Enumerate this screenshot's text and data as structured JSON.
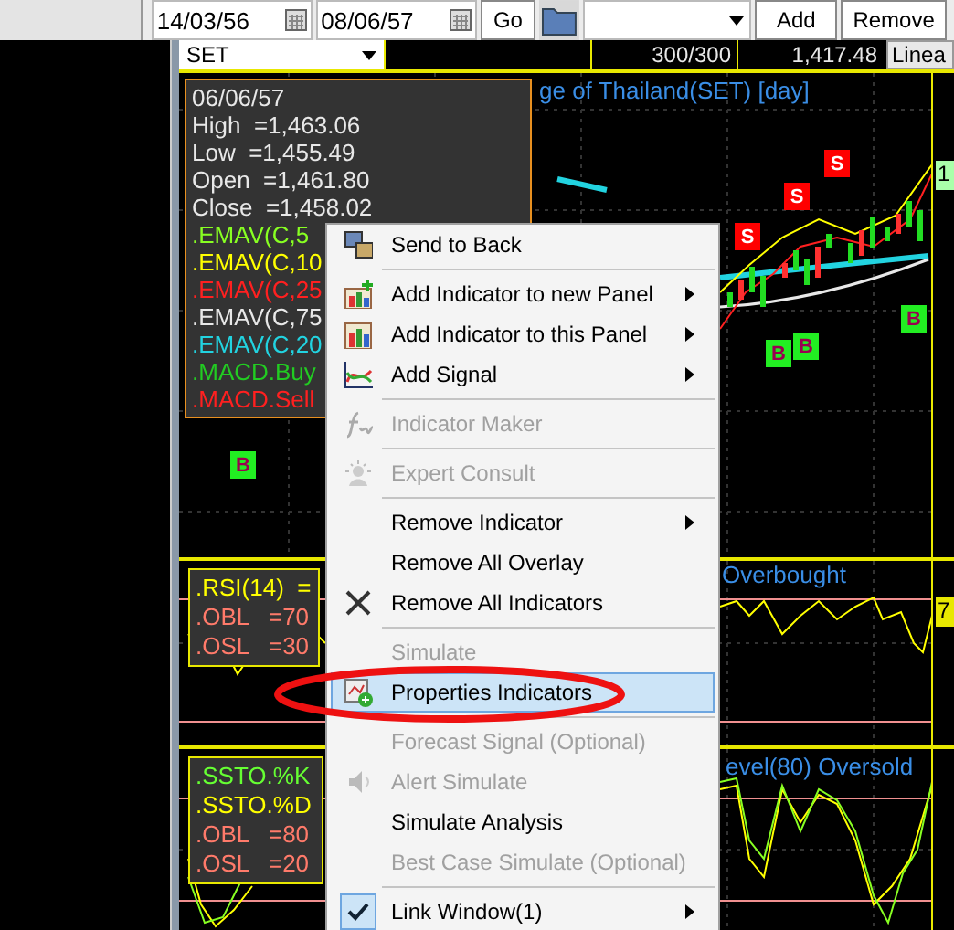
{
  "toolbar": {
    "start_date": "14/03/56",
    "end_date": "08/06/57",
    "go": "Go",
    "add": "Add",
    "remove": "Remove"
  },
  "chart_header": {
    "symbol": "SET",
    "count": "300/300",
    "price": "1,417.48",
    "mode": "Linea"
  },
  "main_panel": {
    "title": "ge of Thailand(SET) [day]",
    "axis_label": "1",
    "info": [
      {
        "text": "06/06/57",
        "color": "#e8e8e8"
      },
      {
        "text": "High  =1,463.06",
        "color": "#e8e8e8"
      },
      {
        "text": "Low  =1,455.49",
        "color": "#e8e8e8"
      },
      {
        "text": "Open  =1,461.80",
        "color": "#e8e8e8"
      },
      {
        "text": "Close  =1,458.02",
        "color": "#e8e8e8"
      },
      {
        "text": ".EMAV(C,5",
        "color": "#88ff22"
      },
      {
        "text": ".EMAV(C,10",
        "color": "#ffff00"
      },
      {
        "text": ".EMAV(C,25",
        "color": "#ff2020"
      },
      {
        "text": ".EMAV(C,75",
        "color": "#e8e8e8"
      },
      {
        "text": ".EMAV(C,20",
        "color": "#22d3e0"
      },
      {
        "text": ".MACD.Buy",
        "color": "#22cc22"
      },
      {
        "text": ".MACD.Sell",
        "color": "#ff2020"
      }
    ],
    "signals": [
      {
        "kind": "buy",
        "label": "B"
      },
      {
        "kind": "sell",
        "label": "S"
      },
      {
        "kind": "sell",
        "label": "S"
      },
      {
        "kind": "sell",
        "label": "S"
      },
      {
        "kind": "buy",
        "label": "B"
      },
      {
        "kind": "buy",
        "label": "B"
      },
      {
        "kind": "buy",
        "label": "B"
      }
    ]
  },
  "rsi_panel": {
    "title": "Overbought",
    "axis_label": "7",
    "info": [
      {
        "text": ".RSI(14)  =",
        "color": "#ffff00"
      },
      {
        "text": ".OBL   =70",
        "color": "#ff7a6a"
      },
      {
        "text": ".OSL   =30",
        "color": "#ff7a6a"
      }
    ]
  },
  "ssto_panel": {
    "title": "evel(80) Oversold",
    "info": [
      {
        "text": ".SSTO.%K",
        "color": "#66ff33"
      },
      {
        "text": ".SSTO.%D",
        "color": "#ffff00"
      },
      {
        "text": ".OBL   =80",
        "color": "#ff7a6a"
      },
      {
        "text": ".OSL   =20",
        "color": "#ff7a6a"
      }
    ]
  },
  "menu": {
    "groups": [
      {
        "items": [
          {
            "label": "Send to Back",
            "disabled": false,
            "has_submenu": false,
            "checked": false,
            "selected": false
          }
        ]
      },
      {
        "items": [
          {
            "label": "Add Indicator to new Panel",
            "disabled": false,
            "has_submenu": true,
            "checked": false,
            "selected": false
          },
          {
            "label": "Add Indicator to this Panel",
            "disabled": false,
            "has_submenu": true,
            "checked": false,
            "selected": false
          },
          {
            "label": "Add Signal",
            "disabled": false,
            "has_submenu": true,
            "checked": false,
            "selected": false
          }
        ]
      },
      {
        "items": [
          {
            "label": "Indicator Maker",
            "disabled": true,
            "has_submenu": false,
            "checked": false,
            "selected": false
          }
        ]
      },
      {
        "items": [
          {
            "label": "Expert Consult",
            "disabled": true,
            "has_submenu": false,
            "checked": false,
            "selected": false
          }
        ]
      },
      {
        "items": [
          {
            "label": "Remove Indicator",
            "disabled": false,
            "has_submenu": true,
            "checked": false,
            "selected": false
          },
          {
            "label": "Remove All Overlay",
            "disabled": false,
            "has_submenu": false,
            "checked": false,
            "selected": false
          },
          {
            "label": "Remove All Indicators",
            "disabled": false,
            "has_submenu": false,
            "checked": false,
            "selected": false
          }
        ]
      },
      {
        "items": [
          {
            "label": "Simulate",
            "disabled": true,
            "has_submenu": false,
            "checked": false,
            "selected": false
          },
          {
            "label": "Properties Indicators",
            "disabled": false,
            "has_submenu": false,
            "checked": false,
            "selected": true
          }
        ]
      },
      {
        "items": [
          {
            "label": "Forecast Signal (Optional)",
            "disabled": true,
            "has_submenu": false,
            "checked": false,
            "selected": false
          },
          {
            "label": "Alert Simulate",
            "disabled": true,
            "has_submenu": false,
            "checked": false,
            "selected": false
          },
          {
            "label": "Simulate Analysis",
            "disabled": false,
            "has_submenu": false,
            "checked": false,
            "selected": false
          },
          {
            "label": "Best Case Simulate (Optional)",
            "disabled": true,
            "has_submenu": false,
            "checked": false,
            "selected": false
          }
        ]
      },
      {
        "items": [
          {
            "label": "Link Window(1)",
            "disabled": false,
            "has_submenu": true,
            "checked": true,
            "selected": false
          }
        ]
      }
    ]
  }
}
